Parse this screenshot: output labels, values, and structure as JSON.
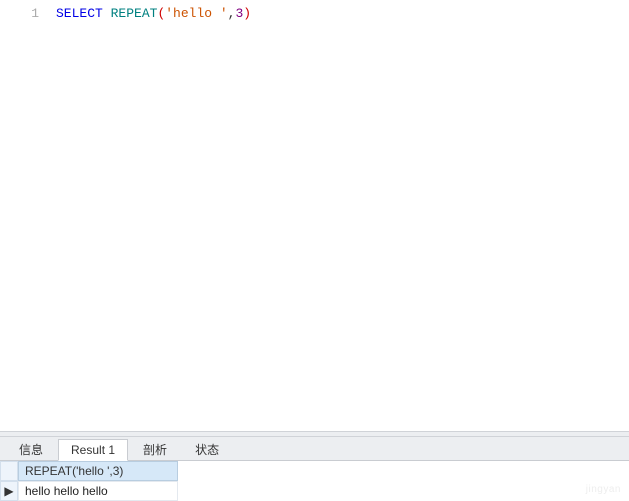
{
  "editor": {
    "line_num": "1",
    "tokens": {
      "kw_select": "SELECT",
      "fn_repeat": "REPEAT",
      "str_arg": "'hello '",
      "comma": ",",
      "num_arg": "3"
    }
  },
  "tabs": {
    "info": "信息",
    "result1": "Result 1",
    "analyze": "剖析",
    "status": "状态"
  },
  "grid": {
    "column_header": "REPEAT('hello ',3)",
    "rows": [
      {
        "indicator": "▶",
        "cell": "hello hello hello"
      }
    ]
  },
  "watermark": "jingyan"
}
